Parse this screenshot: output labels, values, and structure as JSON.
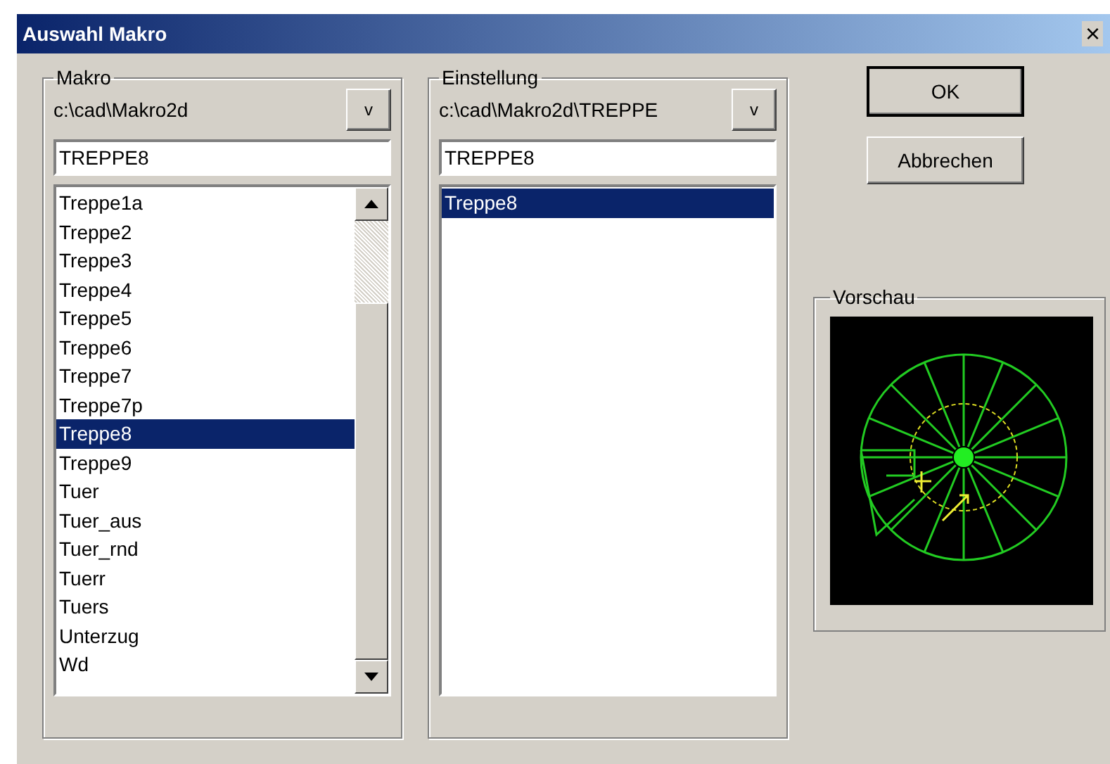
{
  "window": {
    "title": "Auswahl Makro",
    "close": "×"
  },
  "makro": {
    "legend": "Makro",
    "path": "c:\\cad\\Makro2d",
    "browse": "v",
    "input": "TREPPE8",
    "items": [
      {
        "label": "Treppe1a",
        "selected": false
      },
      {
        "label": "Treppe2",
        "selected": false
      },
      {
        "label": "Treppe3",
        "selected": false
      },
      {
        "label": "Treppe4",
        "selected": false
      },
      {
        "label": "Treppe5",
        "selected": false
      },
      {
        "label": "Treppe6",
        "selected": false
      },
      {
        "label": "Treppe7",
        "selected": false
      },
      {
        "label": "Treppe7p",
        "selected": false
      },
      {
        "label": "Treppe8",
        "selected": true
      },
      {
        "label": "Treppe9",
        "selected": false
      },
      {
        "label": "Tuer",
        "selected": false
      },
      {
        "label": "Tuer_aus",
        "selected": false
      },
      {
        "label": "Tuer_rnd",
        "selected": false
      },
      {
        "label": "Tuerr",
        "selected": false
      },
      {
        "label": "Tuers",
        "selected": false
      },
      {
        "label": "Unterzug",
        "selected": false
      },
      {
        "label": "Wd",
        "selected": false
      }
    ]
  },
  "einstellung": {
    "legend": "Einstellung",
    "path": "c:\\cad\\Makro2d\\TREPPE",
    "browse": "v",
    "input": "TREPPE8",
    "items": [
      {
        "label": "Treppe8",
        "selected": true
      }
    ]
  },
  "buttons": [
    {
      "label": "OK",
      "default": true
    },
    {
      "label": "Abbrechen",
      "default": false
    }
  ],
  "preview": {
    "legend": "Vorschau"
  }
}
